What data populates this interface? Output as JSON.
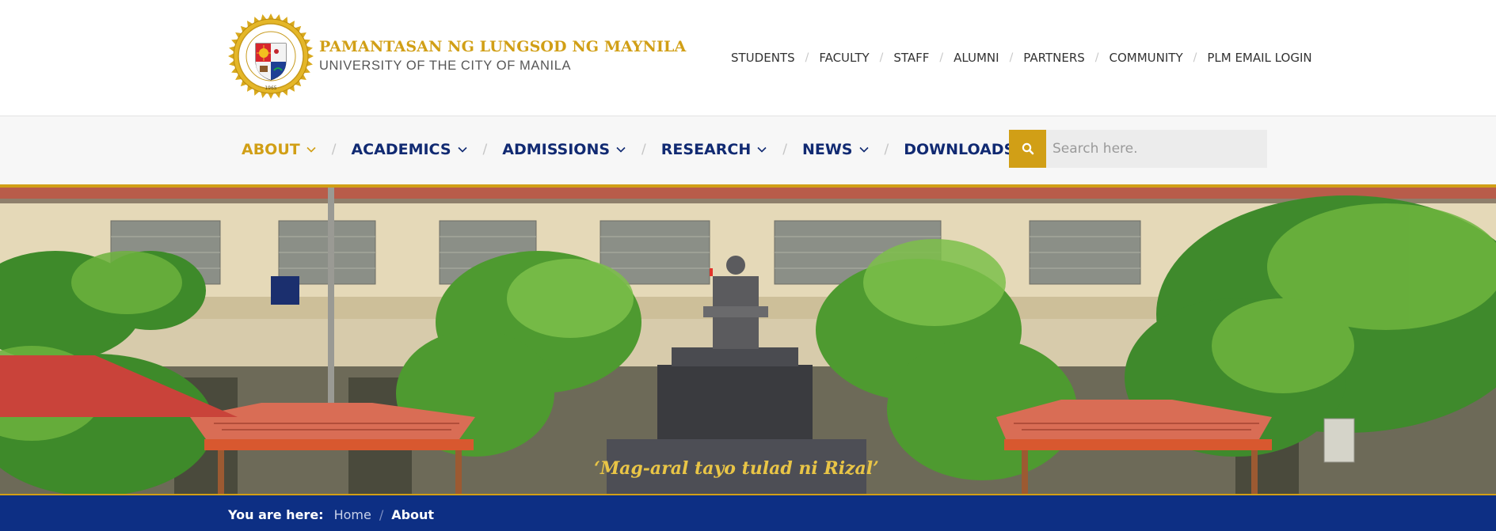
{
  "brand": {
    "title": "PAMANTASAN NG LUNGSOD NG MAYNILA",
    "subtitle": "UNIVERSITY OF THE CITY OF MANILA",
    "logo_ring_text": "PAMANTASAN NG LUNGSOD NG MAYNILA",
    "logo_year": "1965",
    "gold": "#d19f16",
    "navy": "#112a72"
  },
  "audience_nav": [
    "STUDENTS",
    "FACULTY",
    "STAFF",
    "ALUMNI",
    "PARTNERS",
    "COMMUNITY",
    "PLM EMAIL LOGIN"
  ],
  "main_nav": {
    "items": [
      {
        "label": "ABOUT",
        "dropdown": true,
        "active": true
      },
      {
        "label": "ACADEMICS",
        "dropdown": true,
        "active": false
      },
      {
        "label": "ADMISSIONS",
        "dropdown": true,
        "active": false
      },
      {
        "label": "RESEARCH",
        "dropdown": true,
        "active": false
      },
      {
        "label": "NEWS",
        "dropdown": true,
        "active": false
      },
      {
        "label": "DOWNLOADS",
        "dropdown": false,
        "active": false
      }
    ],
    "search_placeholder": "Search here.",
    "search_icon": "search-icon"
  },
  "hero": {
    "monument_inscription": "‘Mag-aral tayo tulad ni Rizal’"
  },
  "breadcrumb": {
    "label": "You are here:",
    "home": "Home",
    "current": "About"
  }
}
